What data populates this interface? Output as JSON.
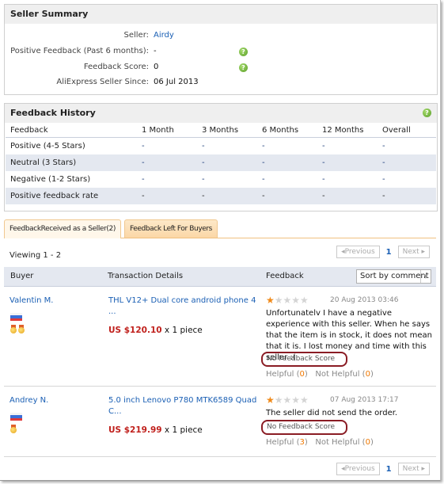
{
  "seller_summary": {
    "title": "Seller Summary",
    "rows": [
      {
        "label": "Seller:",
        "value": "Airdy",
        "link": true,
        "help": false
      },
      {
        "label": "Positive Feedback (Past 6 months):",
        "value": "-",
        "link": false,
        "help": true
      },
      {
        "label": "Feedback Score:",
        "value": "0",
        "link": false,
        "help": true
      },
      {
        "label": "AliExpress Seller Since:",
        "value": "06 Jul 2013",
        "link": false,
        "help": false
      }
    ],
    "help_icon": "question-mark-icon"
  },
  "feedback_history": {
    "title": "Feedback History",
    "columns": [
      "Feedback",
      "1 Month",
      "3 Months",
      "6 Months",
      "12 Months",
      "Overall"
    ],
    "rows": [
      {
        "label": "Positive (4-5 Stars)",
        "values": [
          "-",
          "-",
          "-",
          "-",
          "-"
        ]
      },
      {
        "label": "Neutral (3 Stars)",
        "values": [
          "-",
          "-",
          "-",
          "-",
          "-"
        ]
      },
      {
        "label": "Negative (1-2 Stars)",
        "values": [
          "-",
          "-",
          "-",
          "-",
          "-"
        ]
      },
      {
        "label": "Positive feedback rate",
        "values": [
          "-",
          "-",
          "-",
          "-",
          "-"
        ]
      }
    ]
  },
  "tabs": [
    {
      "label": "FeedbackReceived as a Seller(2)",
      "active": true
    },
    {
      "label": "Feedback Left For Buyers",
      "active": false
    }
  ],
  "viewing": "Viewing 1 - 2",
  "pager": {
    "previous": "◂Previous",
    "current": "1",
    "next": "Next ▸"
  },
  "list_header": {
    "buyer": "Buyer",
    "transaction": "Transaction Details",
    "feedback": "Feedback",
    "sort_selected": "Sort by comment"
  },
  "entries": [
    {
      "buyer": "Valentin M.",
      "flag": "russia-flag",
      "medals": 2,
      "product": "THL V12+ Dual core android phone 4 ...",
      "price": "US $120.10",
      "quantity": "x 1 piece",
      "stars": 1,
      "date": "20 Aug 2013 03:46",
      "comment": "Unfortunatelv I have a negative experience with this seller. When he says that the item is in stock, it does not mean that it is. I lost money and time with this seller :(",
      "score": "No Feedback Score",
      "helpful_label": "Helpful",
      "helpful": "0",
      "not_helpful_label": "Not Helpful",
      "not_helpful": "0"
    },
    {
      "buyer": "Andrey N.",
      "flag": "russia-flag",
      "medals": 1,
      "product": "5.0 inch Lenovo P780 MTK6589 Quad C...",
      "price": "US $219.99",
      "quantity": "x 1 piece",
      "stars": 1,
      "date": "07 Aug 2013 17:17",
      "comment": "The seller did not send the order.",
      "score": "No Feedback Score",
      "helpful_label": "Helpful",
      "helpful": "3",
      "not_helpful_label": "Not Helpful",
      "not_helpful": "0"
    }
  ],
  "colors": {
    "link": "#1a5fb4",
    "price": "#c0201c",
    "star_on": "#f08a1a",
    "highlight_oval": "#8a1c24",
    "count": "#f07800"
  }
}
